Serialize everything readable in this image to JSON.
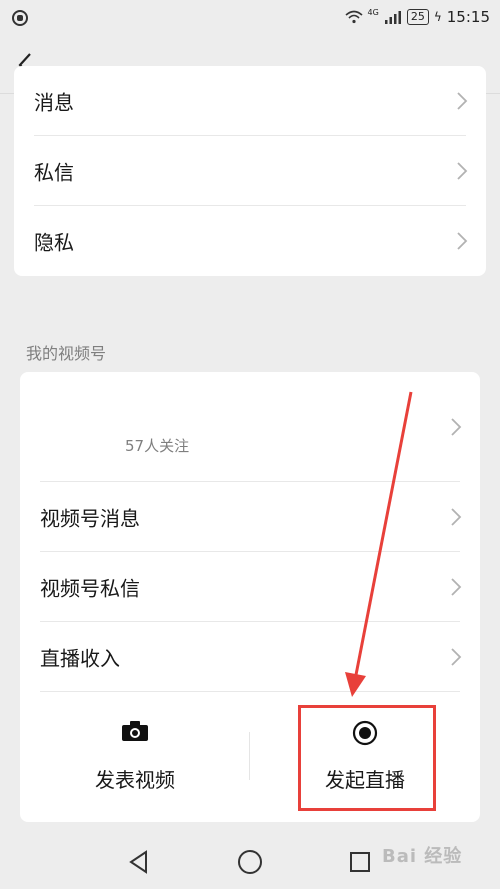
{
  "status_bar": {
    "network": "4G",
    "battery": "25",
    "time": "15:15"
  },
  "settings_card": {
    "items": [
      {
        "label": "消息"
      },
      {
        "label": "私信"
      },
      {
        "label": "隐私"
      }
    ]
  },
  "channels_section": {
    "title": "我的视频号",
    "profile": {
      "followers_text": "57人关注"
    },
    "items": [
      {
        "label": "视频号消息"
      },
      {
        "label": "视频号私信"
      },
      {
        "label": "直播收入"
      }
    ],
    "actions": {
      "post_video": {
        "label": "发表视频",
        "icon": "camera-icon"
      },
      "start_live": {
        "label": "发起直播",
        "icon": "live-record-icon"
      }
    }
  },
  "annotation": {
    "color": "#e8403a"
  },
  "watermark": {
    "text": "Bai 经验"
  }
}
